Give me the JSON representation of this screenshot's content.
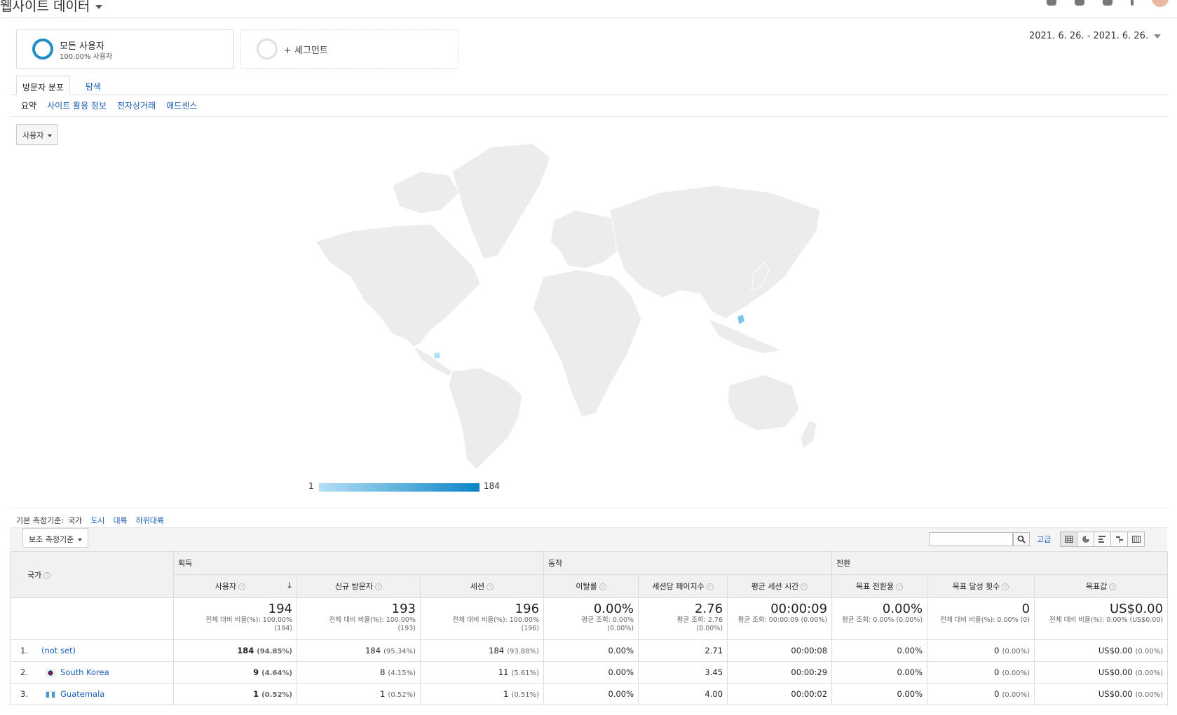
{
  "app": {
    "title": "웹사이트 데이터"
  },
  "segments": [
    {
      "name": "모든 사용자",
      "sub": "100.00% 사용자"
    },
    {
      "name": "+ 세그먼트",
      "sub": ""
    }
  ],
  "date_range": "2021. 6. 26. - 2021. 6. 26.",
  "tabs": [
    {
      "label": "방문자 분포",
      "active": true
    },
    {
      "label": "탐색",
      "active": false
    }
  ],
  "subnav": [
    {
      "label": "요약",
      "active": true
    },
    {
      "label": "사이트 활용 정보",
      "active": false
    },
    {
      "label": "전자상거래",
      "active": false
    },
    {
      "label": "애드센스",
      "active": false
    }
  ],
  "metric_dropdown": "사용자",
  "map": {
    "legend_min": "1",
    "legend_max": "184",
    "highlight_color_low": "#b3dff5",
    "highlight_color_high": "#0b84c6",
    "land_color": "#ececec",
    "highlighted": [
      {
        "country": "South Korea",
        "value": 9
      },
      {
        "country": "Guatemala",
        "value": 1
      }
    ]
  },
  "primary_dimension": {
    "label": "기본 측정기준:",
    "options": [
      {
        "label": "국가",
        "active": true
      },
      {
        "label": "도시",
        "active": false
      },
      {
        "label": "대륙",
        "active": false
      },
      {
        "label": "하위대륙",
        "active": false
      }
    ]
  },
  "secondary_dimension": "보조 측정기준",
  "advanced_label": "고급",
  "table": {
    "dim_header": "국가",
    "groups": [
      "획득",
      "동작",
      "전환"
    ],
    "columns": [
      "사용자",
      "신규 방문자",
      "세션",
      "이탈률",
      "세션당 페이지수",
      "평균 세션 시간",
      "목표 전환율",
      "목표 달성 횟수",
      "목표값"
    ],
    "totals": [
      {
        "big": "194",
        "sub1": "전체 대비 비율(%): 100.00%",
        "sub2": "(194)"
      },
      {
        "big": "193",
        "sub1": "전체 대비 비율(%): 100.00%",
        "sub2": "(193)"
      },
      {
        "big": "196",
        "sub1": "전체 대비 비율(%): 100.00%",
        "sub2": "(196)"
      },
      {
        "big": "0.00%",
        "sub1": "평균 조회: 0.00%",
        "sub2": "(0.00%)"
      },
      {
        "big": "2.76",
        "sub1": "평균 조회: 2.76",
        "sub2": "(0.00%)"
      },
      {
        "big": "00:00:09",
        "sub1": "평균 조회: 00:00:09 (0.00%)",
        "sub2": ""
      },
      {
        "big": "0.00%",
        "sub1": "평균 조회: 0.00% (0.00%)",
        "sub2": ""
      },
      {
        "big": "0",
        "sub1": "전체 대비 비율(%): 0.00% (0)",
        "sub2": ""
      },
      {
        "big": "US$0.00",
        "sub1": "전체 대비 비율(%): 0.00% (US$0.00)",
        "sub2": ""
      }
    ],
    "rows": [
      {
        "idx": "1.",
        "country": "(not set)",
        "flag": "",
        "users": "184",
        "users_pct": "(94.85%)",
        "new": "184",
        "new_pct": "(95.34%)",
        "sessions": "184",
        "sessions_pct": "(93.88%)",
        "bounce": "0.00%",
        "pps": "2.71",
        "dur": "00:00:08",
        "conv": "0.00%",
        "goals": "0",
        "goals_pct": "(0.00%)",
        "value": "US$0.00",
        "value_pct": "(0.00%)"
      },
      {
        "idx": "2.",
        "country": "South Korea",
        "flag": "kr",
        "users": "9",
        "users_pct": "(4.64%)",
        "new": "8",
        "new_pct": "(4.15%)",
        "sessions": "11",
        "sessions_pct": "(5.61%)",
        "bounce": "0.00%",
        "pps": "3.45",
        "dur": "00:00:29",
        "conv": "0.00%",
        "goals": "0",
        "goals_pct": "(0.00%)",
        "value": "US$0.00",
        "value_pct": "(0.00%)"
      },
      {
        "idx": "3.",
        "country": "Guatemala",
        "flag": "gt",
        "users": "1",
        "users_pct": "(0.52%)",
        "new": "1",
        "new_pct": "(0.52%)",
        "sessions": "1",
        "sessions_pct": "(0.51%)",
        "bounce": "0.00%",
        "pps": "4.00",
        "dur": "00:00:02",
        "conv": "0.00%",
        "goals": "0",
        "goals_pct": "(0.00%)",
        "value": "US$0.00",
        "value_pct": "(0.00%)"
      }
    ]
  }
}
